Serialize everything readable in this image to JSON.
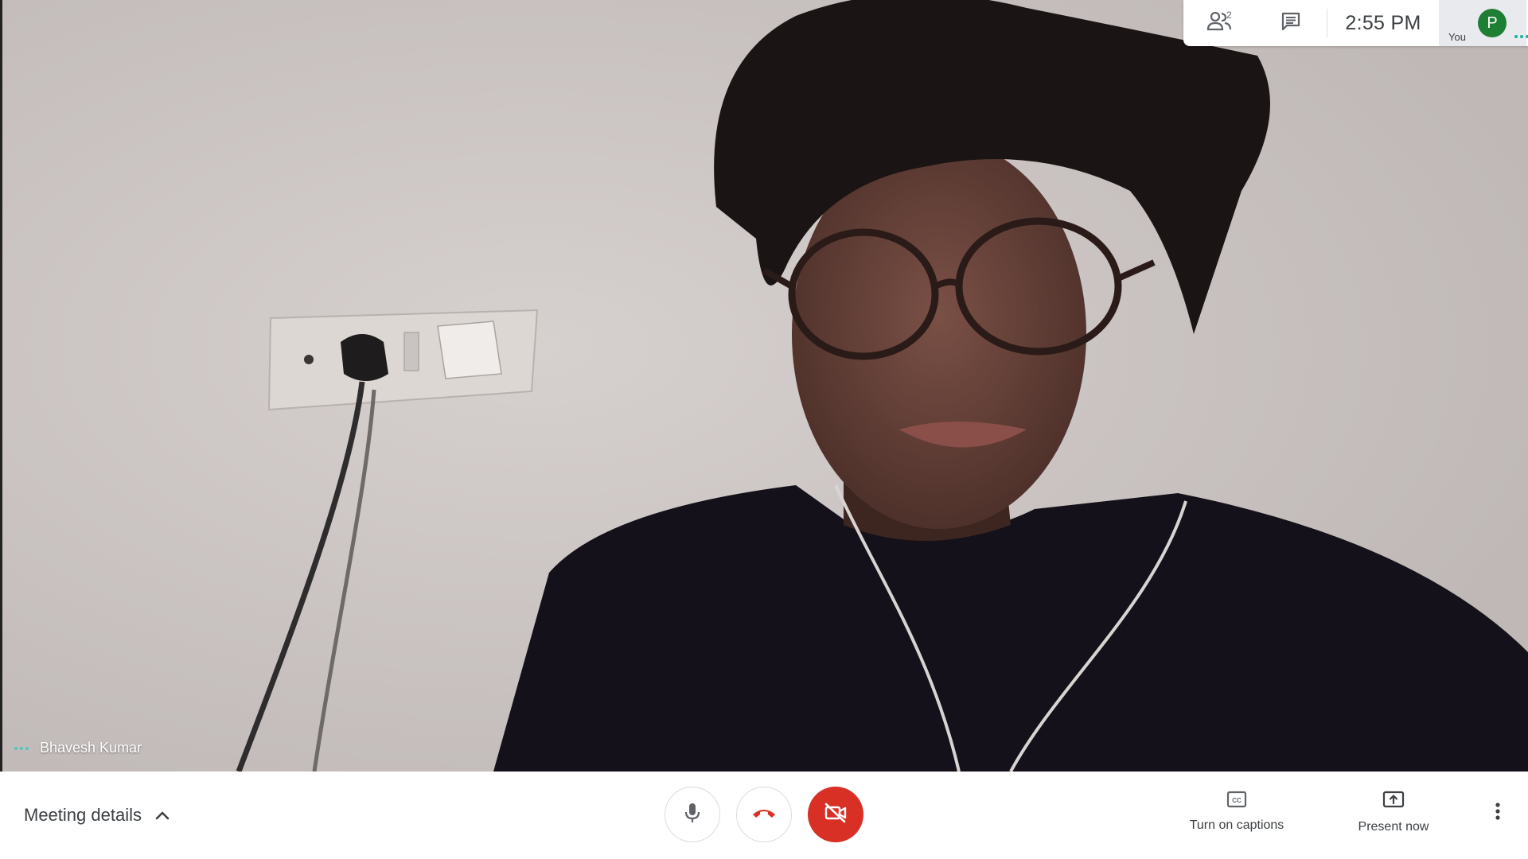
{
  "video": {
    "participant_name": "Bhavesh Kumar"
  },
  "top_panel": {
    "people_icon": "people-icon",
    "people_count": "2",
    "chat_icon": "chat-icon",
    "time": "2:55 PM",
    "you_label": "You",
    "avatar_initial": "P",
    "avatar_color": "#1e7e34"
  },
  "bottom_bar": {
    "meeting_details_label": "Meeting details",
    "mic_icon": "microphone-icon",
    "hangup_icon": "hang-up-icon",
    "camera_icon": "camera-off-icon",
    "captions_label": "Turn on captions",
    "present_label": "Present now",
    "more_icon": "more-vertical-icon",
    "danger_color": "#d93025"
  }
}
